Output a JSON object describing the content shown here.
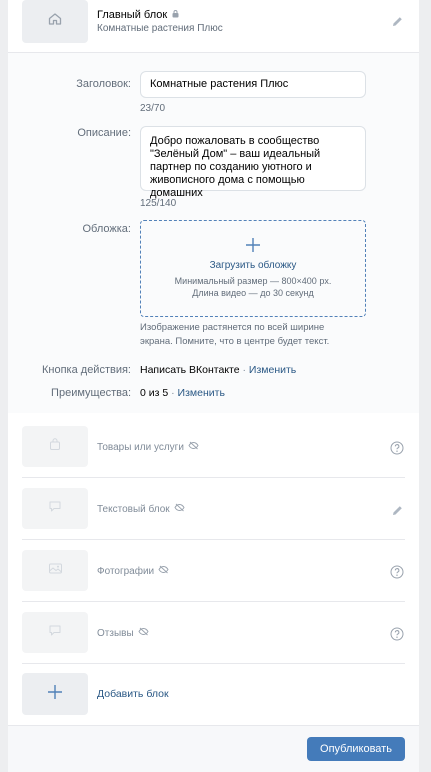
{
  "main_block": {
    "title": "Главный блок",
    "subtitle": "Комнатные растения Плюс",
    "icons": [
      "home-icon",
      "lock-icon",
      "pencil-icon"
    ]
  },
  "form": {
    "title_label": "Заголовок:",
    "title_value": "Комнатные растения Плюс",
    "title_counter": "23/70",
    "desc_label": "Описание:",
    "desc_value": "Добро пожаловать в сообщество \"Зелёный Дом\" – ваш идеальный партнер по созданию уютного и живописного дома с помощью домашних",
    "desc_counter": "125/140",
    "cover_label": "Обложка:",
    "cover_upload": "Загрузить обложку",
    "cover_min_size": "Минимальный размер — 800×400 px.",
    "cover_video_len": "Длина видео — до 30 секунд",
    "cover_hint": "Изображение растянется по всей ширине экрана. Помните, что в центре будет текст.",
    "action_label": "Кнопка действия:",
    "action_value": "Написать ВКонтакте",
    "action_change": "Изменить",
    "benefits_label": "Преимущества:",
    "benefits_value": "0 из 5",
    "benefits_change": "Изменить",
    "separator": " · "
  },
  "blocks": [
    {
      "title": "Товары или услуги",
      "icon": "bag-icon",
      "action_icon": "help-icon"
    },
    {
      "title": "Текстовый блок",
      "icon": "message-icon",
      "action_icon": "pencil-icon"
    },
    {
      "title": "Фотографии",
      "icon": "photo-icon",
      "action_icon": "help-icon"
    },
    {
      "title": "Отзывы",
      "icon": "message-icon",
      "action_icon": "help-icon"
    }
  ],
  "add_block": {
    "label": "Добавить блок"
  },
  "publish": {
    "label": "Опубликовать"
  },
  "colors": {
    "accent": "#2a5885",
    "button": "#447bba",
    "dashed": "#5181b8"
  }
}
